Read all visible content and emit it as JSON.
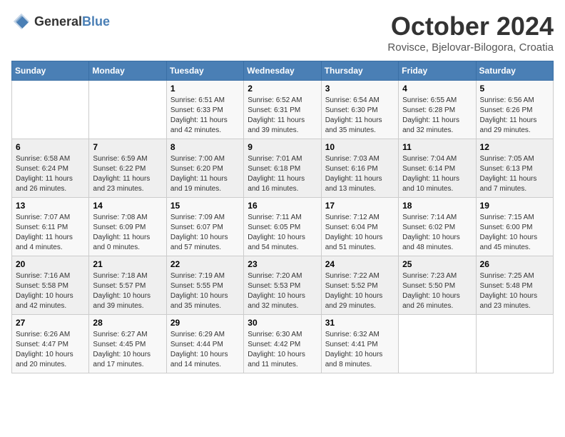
{
  "header": {
    "logo_general": "General",
    "logo_blue": "Blue",
    "month_title": "October 2024",
    "location": "Rovisce, Bjelovar-Bilogora, Croatia"
  },
  "weekdays": [
    "Sunday",
    "Monday",
    "Tuesday",
    "Wednesday",
    "Thursday",
    "Friday",
    "Saturday"
  ],
  "weeks": [
    [
      {
        "day": "",
        "info": ""
      },
      {
        "day": "",
        "info": ""
      },
      {
        "day": "1",
        "info": "Sunrise: 6:51 AM\nSunset: 6:33 PM\nDaylight: 11 hours and 42 minutes."
      },
      {
        "day": "2",
        "info": "Sunrise: 6:52 AM\nSunset: 6:31 PM\nDaylight: 11 hours and 39 minutes."
      },
      {
        "day": "3",
        "info": "Sunrise: 6:54 AM\nSunset: 6:30 PM\nDaylight: 11 hours and 35 minutes."
      },
      {
        "day": "4",
        "info": "Sunrise: 6:55 AM\nSunset: 6:28 PM\nDaylight: 11 hours and 32 minutes."
      },
      {
        "day": "5",
        "info": "Sunrise: 6:56 AM\nSunset: 6:26 PM\nDaylight: 11 hours and 29 minutes."
      }
    ],
    [
      {
        "day": "6",
        "info": "Sunrise: 6:58 AM\nSunset: 6:24 PM\nDaylight: 11 hours and 26 minutes."
      },
      {
        "day": "7",
        "info": "Sunrise: 6:59 AM\nSunset: 6:22 PM\nDaylight: 11 hours and 23 minutes."
      },
      {
        "day": "8",
        "info": "Sunrise: 7:00 AM\nSunset: 6:20 PM\nDaylight: 11 hours and 19 minutes."
      },
      {
        "day": "9",
        "info": "Sunrise: 7:01 AM\nSunset: 6:18 PM\nDaylight: 11 hours and 16 minutes."
      },
      {
        "day": "10",
        "info": "Sunrise: 7:03 AM\nSunset: 6:16 PM\nDaylight: 11 hours and 13 minutes."
      },
      {
        "day": "11",
        "info": "Sunrise: 7:04 AM\nSunset: 6:14 PM\nDaylight: 11 hours and 10 minutes."
      },
      {
        "day": "12",
        "info": "Sunrise: 7:05 AM\nSunset: 6:13 PM\nDaylight: 11 hours and 7 minutes."
      }
    ],
    [
      {
        "day": "13",
        "info": "Sunrise: 7:07 AM\nSunset: 6:11 PM\nDaylight: 11 hours and 4 minutes."
      },
      {
        "day": "14",
        "info": "Sunrise: 7:08 AM\nSunset: 6:09 PM\nDaylight: 11 hours and 0 minutes."
      },
      {
        "day": "15",
        "info": "Sunrise: 7:09 AM\nSunset: 6:07 PM\nDaylight: 10 hours and 57 minutes."
      },
      {
        "day": "16",
        "info": "Sunrise: 7:11 AM\nSunset: 6:05 PM\nDaylight: 10 hours and 54 minutes."
      },
      {
        "day": "17",
        "info": "Sunrise: 7:12 AM\nSunset: 6:04 PM\nDaylight: 10 hours and 51 minutes."
      },
      {
        "day": "18",
        "info": "Sunrise: 7:14 AM\nSunset: 6:02 PM\nDaylight: 10 hours and 48 minutes."
      },
      {
        "day": "19",
        "info": "Sunrise: 7:15 AM\nSunset: 6:00 PM\nDaylight: 10 hours and 45 minutes."
      }
    ],
    [
      {
        "day": "20",
        "info": "Sunrise: 7:16 AM\nSunset: 5:58 PM\nDaylight: 10 hours and 42 minutes."
      },
      {
        "day": "21",
        "info": "Sunrise: 7:18 AM\nSunset: 5:57 PM\nDaylight: 10 hours and 39 minutes."
      },
      {
        "day": "22",
        "info": "Sunrise: 7:19 AM\nSunset: 5:55 PM\nDaylight: 10 hours and 35 minutes."
      },
      {
        "day": "23",
        "info": "Sunrise: 7:20 AM\nSunset: 5:53 PM\nDaylight: 10 hours and 32 minutes."
      },
      {
        "day": "24",
        "info": "Sunrise: 7:22 AM\nSunset: 5:52 PM\nDaylight: 10 hours and 29 minutes."
      },
      {
        "day": "25",
        "info": "Sunrise: 7:23 AM\nSunset: 5:50 PM\nDaylight: 10 hours and 26 minutes."
      },
      {
        "day": "26",
        "info": "Sunrise: 7:25 AM\nSunset: 5:48 PM\nDaylight: 10 hours and 23 minutes."
      }
    ],
    [
      {
        "day": "27",
        "info": "Sunrise: 6:26 AM\nSunset: 4:47 PM\nDaylight: 10 hours and 20 minutes."
      },
      {
        "day": "28",
        "info": "Sunrise: 6:27 AM\nSunset: 4:45 PM\nDaylight: 10 hours and 17 minutes."
      },
      {
        "day": "29",
        "info": "Sunrise: 6:29 AM\nSunset: 4:44 PM\nDaylight: 10 hours and 14 minutes."
      },
      {
        "day": "30",
        "info": "Sunrise: 6:30 AM\nSunset: 4:42 PM\nDaylight: 10 hours and 11 minutes."
      },
      {
        "day": "31",
        "info": "Sunrise: 6:32 AM\nSunset: 4:41 PM\nDaylight: 10 hours and 8 minutes."
      },
      {
        "day": "",
        "info": ""
      },
      {
        "day": "",
        "info": ""
      }
    ]
  ]
}
